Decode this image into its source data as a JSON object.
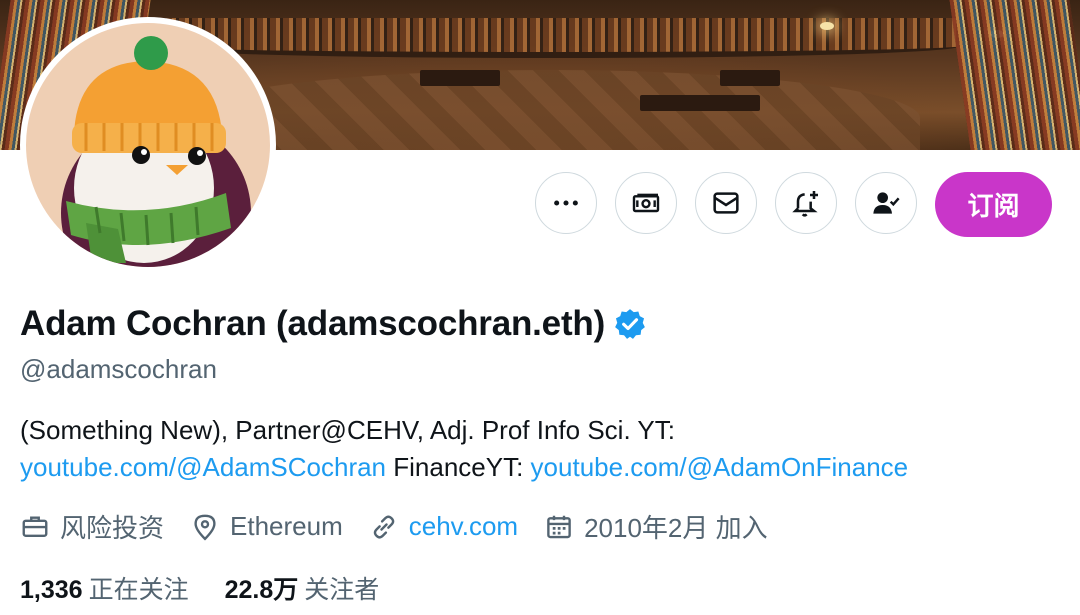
{
  "profile": {
    "display_name": "Adam Cochran (adamscochran.eth)",
    "handle": "@adamscochran",
    "bio_line1": "(Something New), Partner@CEHV, Adj. Prof Info Sci. YT:",
    "bio_link1": "youtube.com/@AdamSCochran",
    "bio_mid": " FinanceYT: ",
    "bio_link2": "youtube.com/@AdamOnFinance"
  },
  "meta": {
    "category": "风险投资",
    "location": "Ethereum",
    "website": "cehv.com",
    "joined": "2010年2月 加入"
  },
  "stats": {
    "following_count": "1,336",
    "following_label": "正在关注",
    "followers_count": "22.8万",
    "followers_label": "关注者"
  },
  "actions": {
    "subscribe_label": "订阅"
  },
  "icons": {
    "more": "more-horizontal-icon",
    "tip": "money-icon",
    "message": "envelope-icon",
    "notify": "bell-plus-icon",
    "following": "person-check-icon",
    "verified": "verified-badge-icon",
    "category": "briefcase-icon",
    "location": "location-pin-icon",
    "website": "link-icon",
    "joined": "calendar-icon"
  },
  "colors": {
    "accent": "#1d9bf0",
    "subscribe": "#c936c9",
    "secondary_text": "#536471",
    "primary_text": "#0f1419"
  }
}
